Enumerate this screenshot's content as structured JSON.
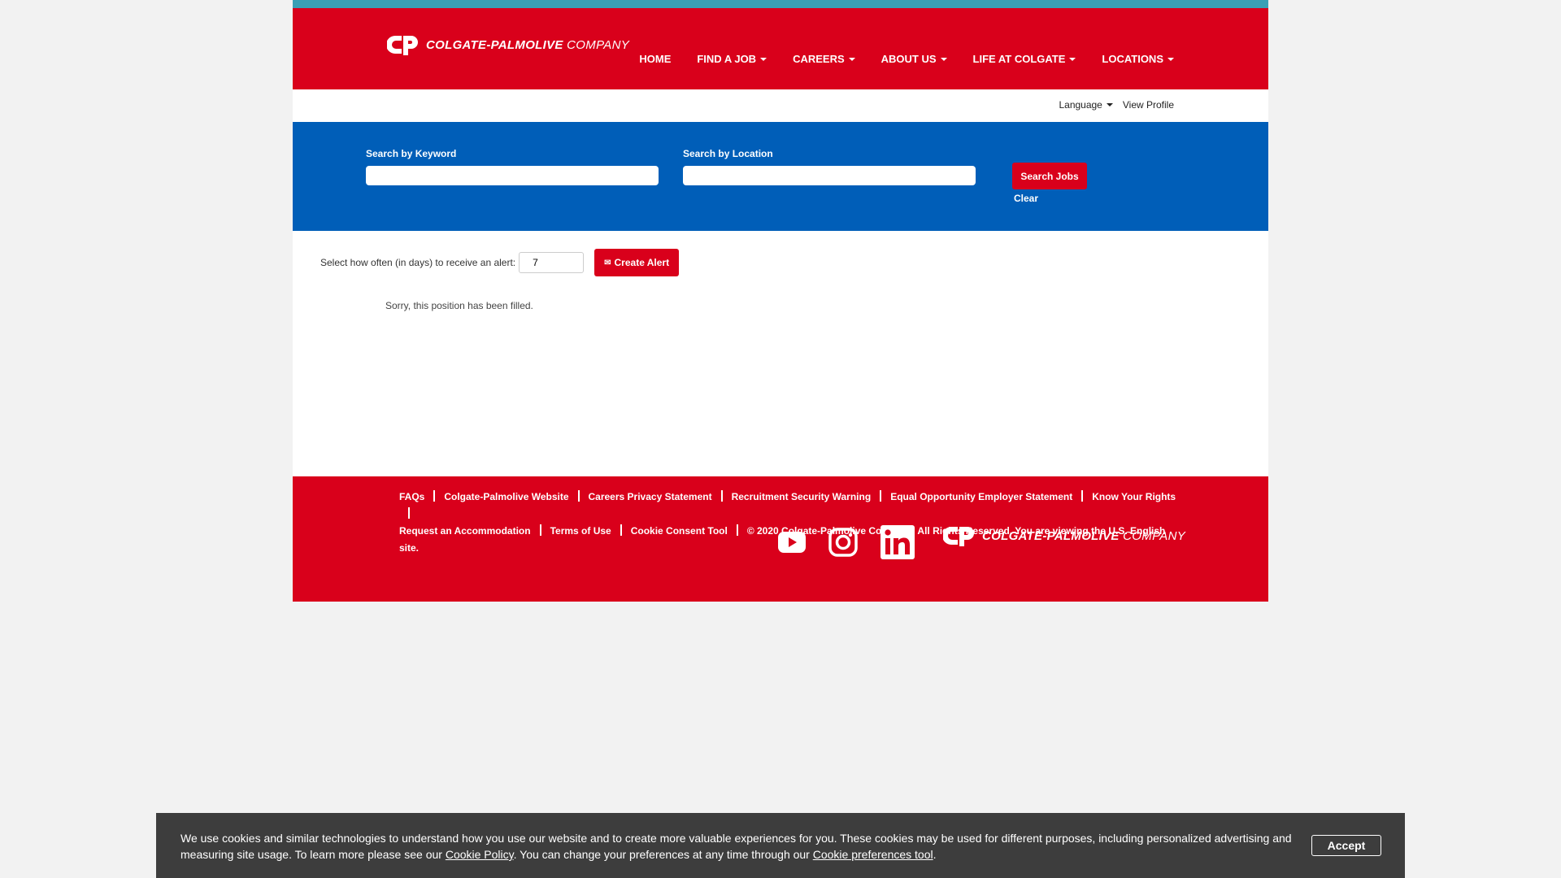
{
  "header": {
    "logo_text": "COLGATE-PALMOLIVE",
    "logo_suffix": "COMPANY",
    "nav": [
      {
        "label": "HOME"
      },
      {
        "label": "FIND A JOB"
      },
      {
        "label": "CAREERS"
      },
      {
        "label": "ABOUT US"
      },
      {
        "label": "LIFE AT COLGATE"
      },
      {
        "label": "LOCATIONS"
      }
    ]
  },
  "subbar": {
    "language": "Language",
    "view_profile": "View Profile"
  },
  "search": {
    "keyword_label": "Search by Keyword",
    "location_label": "Search by Location",
    "keyword_value": "",
    "location_value": "",
    "search_button": "Search Jobs",
    "clear_link": "Clear"
  },
  "alert": {
    "label": "Select how often (in days) to receive an alert:",
    "days_value": "7",
    "button": "Create Alert"
  },
  "main": {
    "message": "Sorry, this position has been filled."
  },
  "footer": {
    "links": [
      "FAQs",
      "Colgate-Palmolive Website",
      "Careers Privacy Statement",
      "Recruitment Security Warning",
      "Equal Opportunity Employer Statement",
      "Know Your Rights",
      "Request an Accommodation",
      "Terms of Use",
      "Cookie Consent Tool"
    ],
    "copyright": "© 2020 Colgate-Palmolive Company. All Rights Reserved. You are viewing the U.S. English site.",
    "social": [
      "youtube-icon",
      "instagram-icon",
      "linkedin-icon"
    ]
  },
  "cookie": {
    "text_1": "We use cookies and similar technologies to understand how you use our website and to create more valuable experiences for you. These cookies may be used for different purposes, including personalized advertising and measuring site usage. To learn more please see our ",
    "policy_link": "Cookie Policy",
    "text_2": ". You can change your preferences at any time through our ",
    "prefs_link": "Cookie preferences tool",
    "text_3": ".",
    "accept": "Accept"
  },
  "colors": {
    "brand_red": "#d9001b",
    "search_blue": "#005eb8",
    "top_strip": "#3aa0b5",
    "cookie_bg": "#3d3d3d"
  }
}
